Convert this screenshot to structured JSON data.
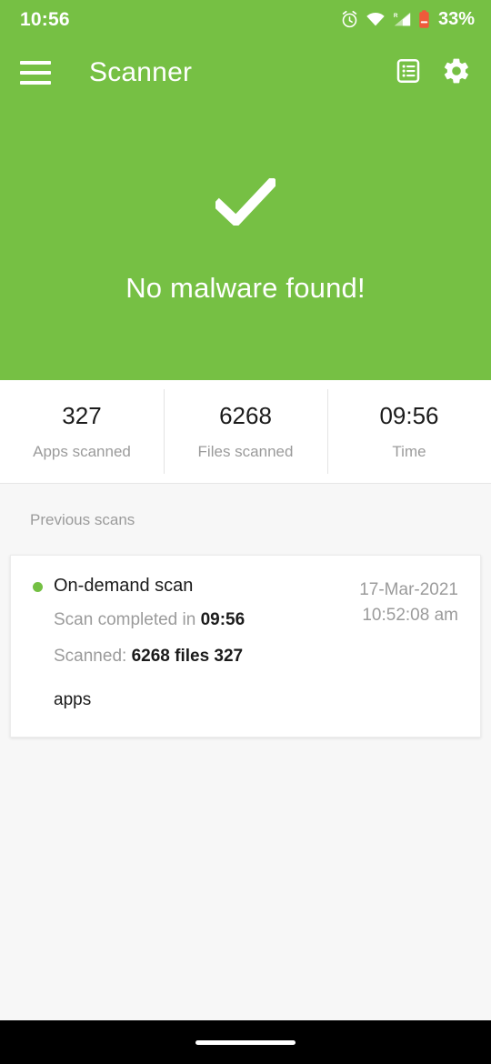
{
  "status_bar": {
    "time": "10:56",
    "battery_percent": "33%",
    "icons": [
      "alarm-icon",
      "wifi-icon",
      "cellular-signal-roaming-icon",
      "battery-low-icon"
    ],
    "roaming_label": "R"
  },
  "toolbar": {
    "menu_icon": "hamburger-menu-icon",
    "title": "Scanner",
    "actions": [
      {
        "name": "scan-log-icon",
        "label": "Scan log"
      },
      {
        "name": "settings-gear-icon",
        "label": "Settings"
      }
    ]
  },
  "hero": {
    "icon": "checkmark-icon",
    "message": "No malware found!",
    "background_color": "#76c044"
  },
  "stats": [
    {
      "value": "327",
      "label": "Apps scanned"
    },
    {
      "value": "6268",
      "label": "Files scanned"
    },
    {
      "value": "09:56",
      "label": "Time"
    }
  ],
  "previous_scans": {
    "section_title": "Previous scans",
    "items": [
      {
        "status_color": "#74c043",
        "title": "On-demand scan",
        "completed_prefix": "Scan completed in ",
        "completed_value": "09:56",
        "scanned_prefix": "Scanned: ",
        "scanned_value": "6268 files 327",
        "scanned_suffix": "apps",
        "date": "17-Mar-2021",
        "time": "10:52:08 am"
      }
    ]
  },
  "navigation_bar": {
    "gesture_pill": "home-gesture-pill"
  }
}
